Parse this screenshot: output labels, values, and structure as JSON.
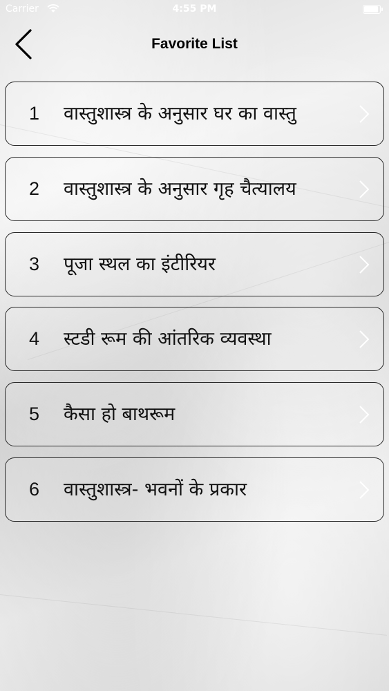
{
  "status_bar": {
    "carrier": "Carrier",
    "time": "4:55 PM"
  },
  "nav": {
    "title": "Favorite List",
    "back_icon": "chevron-left-icon"
  },
  "list": {
    "items": [
      {
        "number": "1",
        "title": "वास्तुशास्त्र के अनुसार घर का वास्तु"
      },
      {
        "number": "2",
        "title": "वास्तुशास्त्र के अनुसार गृह चैत्यालय"
      },
      {
        "number": "3",
        "title": "पूजा स्थल का इंटीरियर"
      },
      {
        "number": "4",
        "title": "स्टडी रूम की आंतरिक व्यवस्था"
      },
      {
        "number": "5",
        "title": "कैसा हो बाथरूम"
      },
      {
        "number": "6",
        "title": "वास्तुशास्त्र- भवनों के प्रकार"
      }
    ],
    "chevron_icon": "chevron-right-icon"
  },
  "colors": {
    "border": "#2a2a2a",
    "text": "#111111",
    "chevron": "#ffffff"
  }
}
